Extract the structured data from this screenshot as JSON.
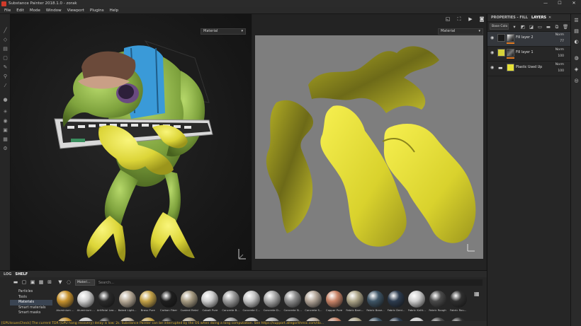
{
  "window": {
    "title": "Substance Painter 2018.1.0 - zorak",
    "controls": [
      "—",
      "☐",
      "✕"
    ]
  },
  "menu": [
    "File",
    "Edit",
    "Mode",
    "Window",
    "Viewport",
    "Plugins",
    "Help"
  ],
  "viewport_3d": {
    "material_mode": "Material"
  },
  "viewport_2d": {
    "material_mode": "Material"
  },
  "right_panel": {
    "tab_properties": "PROPERTIES - FILL",
    "tab_layers": "LAYERS",
    "close": "✕",
    "blend_mode": "Base Colo",
    "layers": [
      {
        "name": "Fill layer 2",
        "blend": "Norm",
        "opacity": "77",
        "selected": true
      },
      {
        "name": "Fill layer 1",
        "blend": "Norm",
        "opacity": "100",
        "selected": false
      },
      {
        "name": "Plastic Used Up",
        "blend": "Norm",
        "opacity": "100",
        "selected": false
      }
    ]
  },
  "shelf": {
    "tab_log": "LOG",
    "tab_shelf": "SHELF",
    "filter_chip": "Materi...",
    "search_placeholder": "Search...",
    "categories": [
      {
        "label": "Particles",
        "active": false
      },
      {
        "label": "Tools",
        "active": false
      },
      {
        "label": "Materials",
        "active": true
      },
      {
        "label": "Smart materials",
        "active": false
      },
      {
        "label": "Smart masks",
        "active": false
      }
    ],
    "materials": [
      {
        "label": "Aluminium ...",
        "color": "#c8932e"
      },
      {
        "label": "Aluminium ...",
        "color": "#cfcfcf"
      },
      {
        "label": "Artificial Lea...",
        "color": "#2a2a2a"
      },
      {
        "label": "Baked Light...",
        "color": "#b8ab98"
      },
      {
        "label": "Brass Pure",
        "color": "#c4a248"
      },
      {
        "label": "Carbon Fiber",
        "color": "#1e1e1e"
      },
      {
        "label": "Coated Metal",
        "color": "#a89c83"
      },
      {
        "label": "Cobalt Pure",
        "color": "#cfcfcf"
      },
      {
        "label": "Concrete B...",
        "color": "#9c9c9c"
      },
      {
        "label": "Concrete C...",
        "color": "#c5c5c5"
      },
      {
        "label": "Concrete D...",
        "color": "#a9a9a9"
      },
      {
        "label": "Concrete Si...",
        "color": "#8d8d8d"
      },
      {
        "label": "Concrete S...",
        "color": "#b3a699"
      },
      {
        "label": "Copper Pure",
        "color": "#c98468"
      },
      {
        "label": "Fabric Bam...",
        "color": "#ada588"
      },
      {
        "label": "Fabric Base...",
        "color": "#3e5566"
      },
      {
        "label": "Fabric Deni...",
        "color": "#2c3b4e"
      },
      {
        "label": "Fabric Knitt...",
        "color": "#cfcfcf"
      },
      {
        "label": "Fabric Rough",
        "color": "#4a4a4a"
      },
      {
        "label": "Fabric Rou...",
        "color": "#2f2f2f"
      }
    ]
  },
  "status": "[GPUIssuesCheck] The current TDR (GPU hang recovery) delay is low: 2s. Substance Painter can be interrupted by the OS when doing a long computation. See https://support.allegorithmic.com/do..."
}
